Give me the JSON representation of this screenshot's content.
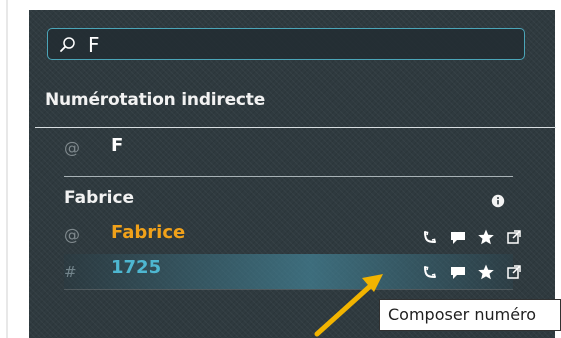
{
  "search": {
    "value": "F",
    "placeholder": ""
  },
  "section": {
    "title": "Numérotation indirecte"
  },
  "rows": [
    {
      "prefix": "@",
      "text": "F",
      "text_color": "#ffffff"
    },
    {
      "prefix": "@",
      "text": "Fabrice",
      "text_color": "#f0a11a"
    },
    {
      "prefix": "#",
      "text": "1725",
      "text_color": "#4eb7d1"
    }
  ],
  "contact": {
    "name": "Fabrice"
  },
  "tooltip": {
    "text": "Composer numéro"
  },
  "icons": {
    "search": "search-icon",
    "info": "info-icon",
    "call": "phone-icon",
    "chat": "chat-icon",
    "favorite": "star-icon",
    "external": "external-link-icon"
  },
  "colors": {
    "panel": "#2f3a3f",
    "accent": "#4ba5b8",
    "arrow": "#f2b400",
    "name_orange": "#f0a11a",
    "number_blue": "#4eb7d1"
  }
}
